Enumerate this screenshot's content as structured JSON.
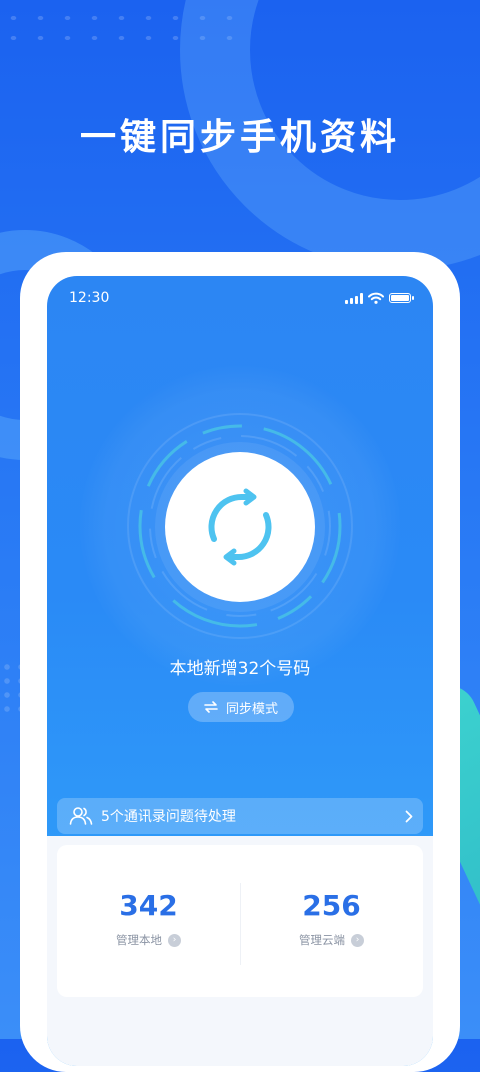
{
  "headline": "一键同步手机资料",
  "status": {
    "time": "12:30"
  },
  "sync": {
    "new_count_text": "本地新增32个号码",
    "mode_label": "同步模式"
  },
  "issues": {
    "text": "5个通讯录问题待处理"
  },
  "stats": [
    {
      "value": "342",
      "label": "管理本地"
    },
    {
      "value": "256",
      "label": "管理云端"
    }
  ],
  "colors": {
    "accent": "#2a6fe6",
    "sync_teal": "#4ec3f0"
  },
  "icons": [
    "signal-icon",
    "wifi-icon",
    "battery-icon",
    "sync-icon",
    "swap-arrows-icon",
    "contacts-icon",
    "chevron-right-icon"
  ]
}
